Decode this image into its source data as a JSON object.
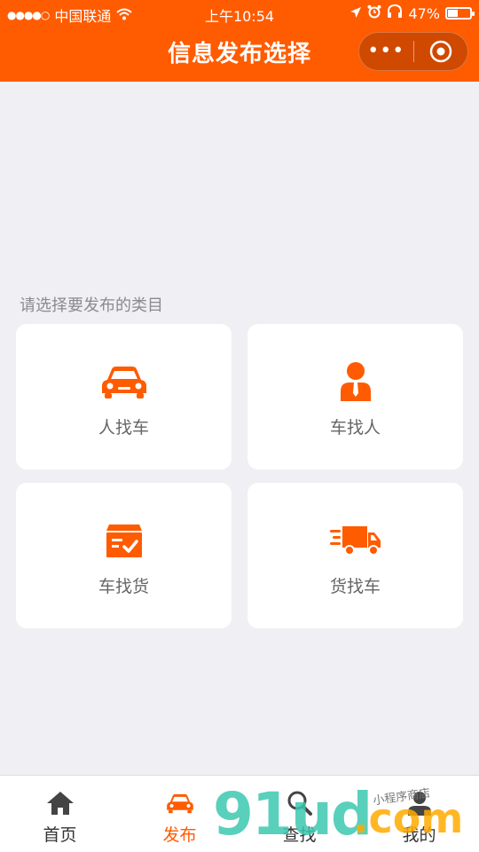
{
  "status_bar": {
    "signal": "●●●●○",
    "carrier": "中国联通",
    "time": "上午10:54",
    "battery": "47%",
    "battery_level": 0.47
  },
  "nav": {
    "title": "信息发布选择",
    "more_icon": "more-dots-icon",
    "close_icon": "target-circle-icon"
  },
  "main": {
    "hint": "请选择要发布的类目",
    "cards": [
      {
        "label": "人找车",
        "icon": "car-icon"
      },
      {
        "label": "车找人",
        "icon": "person-icon"
      },
      {
        "label": "车找货",
        "icon": "cargo-box-icon"
      },
      {
        "label": "货找车",
        "icon": "truck-icon"
      }
    ]
  },
  "tabbar": {
    "tabs": [
      {
        "label": "首页",
        "icon": "home-icon"
      },
      {
        "label": "发布",
        "icon": "car-icon",
        "active": true
      },
      {
        "label": "查找",
        "icon": "search-icon"
      },
      {
        "label": "我的",
        "icon": "user-icon"
      }
    ]
  },
  "watermark": {
    "big": "91ud",
    "dot_com": ".com",
    "small": "小程序商店"
  },
  "colors": {
    "brand": "#ff5b00",
    "background": "#efeff4",
    "watermark_teal": "#3cc8af",
    "watermark_orange": "#ffaa00"
  }
}
